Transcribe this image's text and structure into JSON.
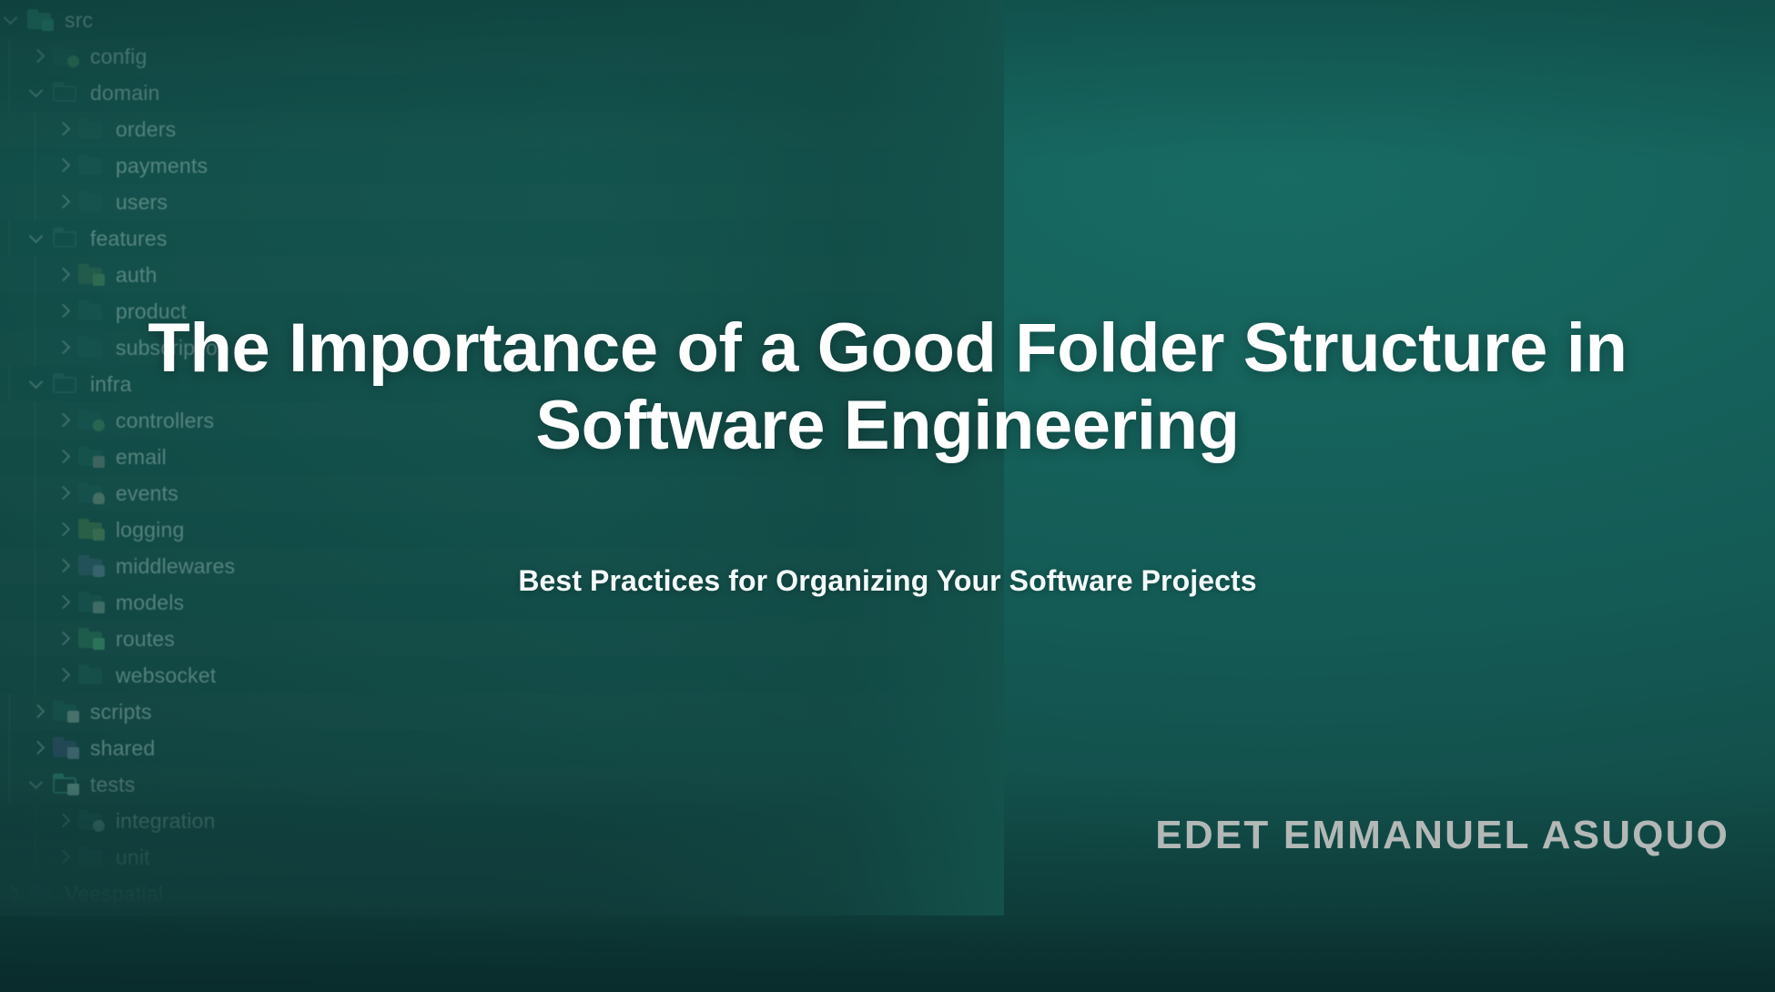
{
  "slide": {
    "title": "The Importance of a Good Folder Structure in Software Engineering",
    "subtitle": "Best Practices for Organizing Your Software Projects",
    "author": "EDET EMMANUEL ASUQUO"
  },
  "theme": {
    "background_dark": "#0d3433",
    "background_mid": "#145a55",
    "background_light": "#176b63",
    "title_color": "#ffffff",
    "subtitle_color": "#f4fbfa",
    "author_color": "#b2b8b6",
    "tree_text_color": "#b9d4cf"
  },
  "file_tree": {
    "items": [
      {
        "label": "src",
        "depth": 0,
        "state": "expanded",
        "chevron": "chevron-down-icon",
        "icon": "folder-code-icon"
      },
      {
        "label": "config",
        "depth": 1,
        "state": "collapsed",
        "chevron": "chevron-right-icon",
        "icon": "folder-gear-icon"
      },
      {
        "label": "domain",
        "depth": 1,
        "state": "expanded",
        "chevron": "chevron-down-icon",
        "icon": "folder-open-icon"
      },
      {
        "label": "orders",
        "depth": 2,
        "state": "collapsed",
        "chevron": "chevron-right-icon",
        "icon": "folder-icon"
      },
      {
        "label": "payments",
        "depth": 2,
        "state": "collapsed",
        "chevron": "chevron-right-icon",
        "icon": "folder-icon"
      },
      {
        "label": "users",
        "depth": 2,
        "state": "collapsed",
        "chevron": "chevron-right-icon",
        "icon": "folder-icon"
      },
      {
        "label": "features",
        "depth": 1,
        "state": "expanded",
        "chevron": "chevron-down-icon",
        "icon": "folder-open-icon"
      },
      {
        "label": "auth",
        "depth": 2,
        "state": "collapsed",
        "chevron": "chevron-right-icon",
        "icon": "folder-lock-icon"
      },
      {
        "label": "product",
        "depth": 2,
        "state": "collapsed",
        "chevron": "chevron-right-icon",
        "icon": "folder-icon"
      },
      {
        "label": "subscription",
        "depth": 2,
        "state": "collapsed",
        "chevron": "chevron-right-icon",
        "icon": "folder-icon"
      },
      {
        "label": "infra",
        "depth": 1,
        "state": "expanded",
        "chevron": "chevron-down-icon",
        "icon": "folder-open-icon"
      },
      {
        "label": "controllers",
        "depth": 2,
        "state": "collapsed",
        "chevron": "chevron-right-icon",
        "icon": "folder-gear-icon"
      },
      {
        "label": "email",
        "depth": 2,
        "state": "collapsed",
        "chevron": "chevron-right-icon",
        "icon": "folder-mail-icon"
      },
      {
        "label": "events",
        "depth": 2,
        "state": "collapsed",
        "chevron": "chevron-right-icon",
        "icon": "folder-bell-icon"
      },
      {
        "label": "logging",
        "depth": 2,
        "state": "collapsed",
        "chevron": "chevron-right-icon",
        "icon": "folder-log-icon"
      },
      {
        "label": "middlewares",
        "depth": 2,
        "state": "collapsed",
        "chevron": "chevron-right-icon",
        "icon": "folder-puzzle-icon"
      },
      {
        "label": "models",
        "depth": 2,
        "state": "collapsed",
        "chevron": "chevron-right-icon",
        "icon": "folder-list-icon"
      },
      {
        "label": "routes",
        "depth": 2,
        "state": "collapsed",
        "chevron": "chevron-right-icon",
        "icon": "folder-route-icon"
      },
      {
        "label": "websocket",
        "depth": 2,
        "state": "collapsed",
        "chevron": "chevron-right-icon",
        "icon": "folder-icon"
      },
      {
        "label": "scripts",
        "depth": 1,
        "state": "collapsed",
        "chevron": "chevron-right-icon",
        "icon": "folder-script-icon"
      },
      {
        "label": "shared",
        "depth": 1,
        "state": "collapsed",
        "chevron": "chevron-right-icon",
        "icon": "folder-shared-icon"
      },
      {
        "label": "tests",
        "depth": 1,
        "state": "expanded",
        "chevron": "chevron-down-icon",
        "icon": "folder-test-icon"
      },
      {
        "label": "integration",
        "depth": 2,
        "state": "collapsed",
        "chevron": "chevron-right-icon",
        "icon": "folder-plug-icon"
      },
      {
        "label": "unit",
        "depth": 2,
        "state": "collapsed",
        "chevron": "chevron-right-icon",
        "icon": "folder-icon"
      },
      {
        "label": "Veespatial",
        "depth": 0,
        "state": "collapsed",
        "chevron": "chevron-right-icon",
        "icon": "folder-icon"
      }
    ]
  }
}
